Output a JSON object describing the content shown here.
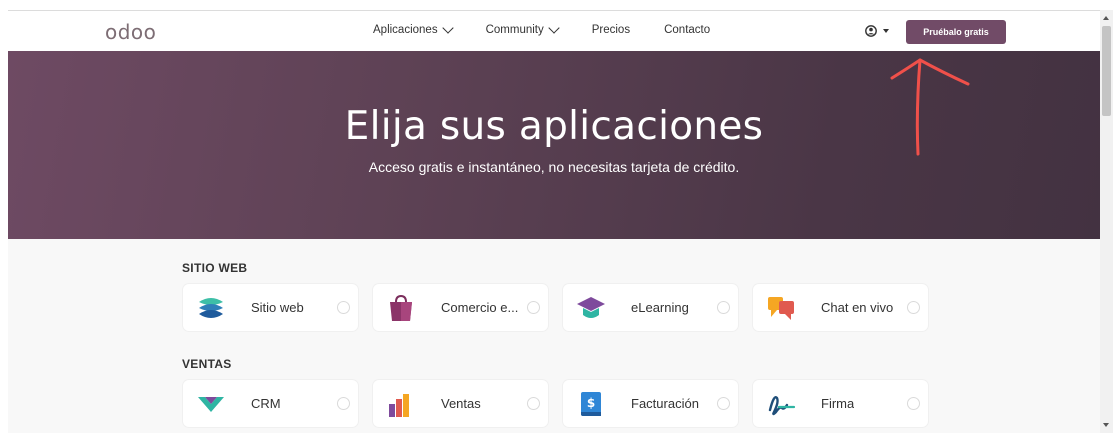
{
  "header": {
    "logo": "odoo",
    "nav": [
      {
        "label": "Aplicaciones",
        "has_dropdown": true
      },
      {
        "label": "Community",
        "has_dropdown": true
      },
      {
        "label": "Precios",
        "has_dropdown": false
      },
      {
        "label": "Contacto",
        "has_dropdown": false
      }
    ],
    "account_icon": "user-circle-icon",
    "cta_label": "Pruébalo gratis"
  },
  "hero": {
    "title": "Elija sus aplicaciones",
    "subtitle": "Acceso gratis e instantáneo, no necesitas tarjeta de crédito."
  },
  "sections": [
    {
      "title": "SITIO WEB",
      "apps": [
        {
          "label": "Sitio web",
          "icon": "website-icon"
        },
        {
          "label": "Comercio e...",
          "icon": "ecommerce-bag-icon"
        },
        {
          "label": "eLearning",
          "icon": "graduation-cap-icon"
        },
        {
          "label": "Chat en vivo",
          "icon": "live-chat-icon"
        }
      ]
    },
    {
      "title": "VENTAS",
      "apps": [
        {
          "label": "CRM",
          "icon": "crm-icon"
        },
        {
          "label": "Ventas",
          "icon": "sales-chart-icon"
        },
        {
          "label": "Facturación",
          "icon": "invoicing-icon"
        },
        {
          "label": "Firma",
          "icon": "signature-icon"
        }
      ]
    }
  ],
  "colors": {
    "brand": "#714b67",
    "annotation_arrow": "#f0504a"
  }
}
